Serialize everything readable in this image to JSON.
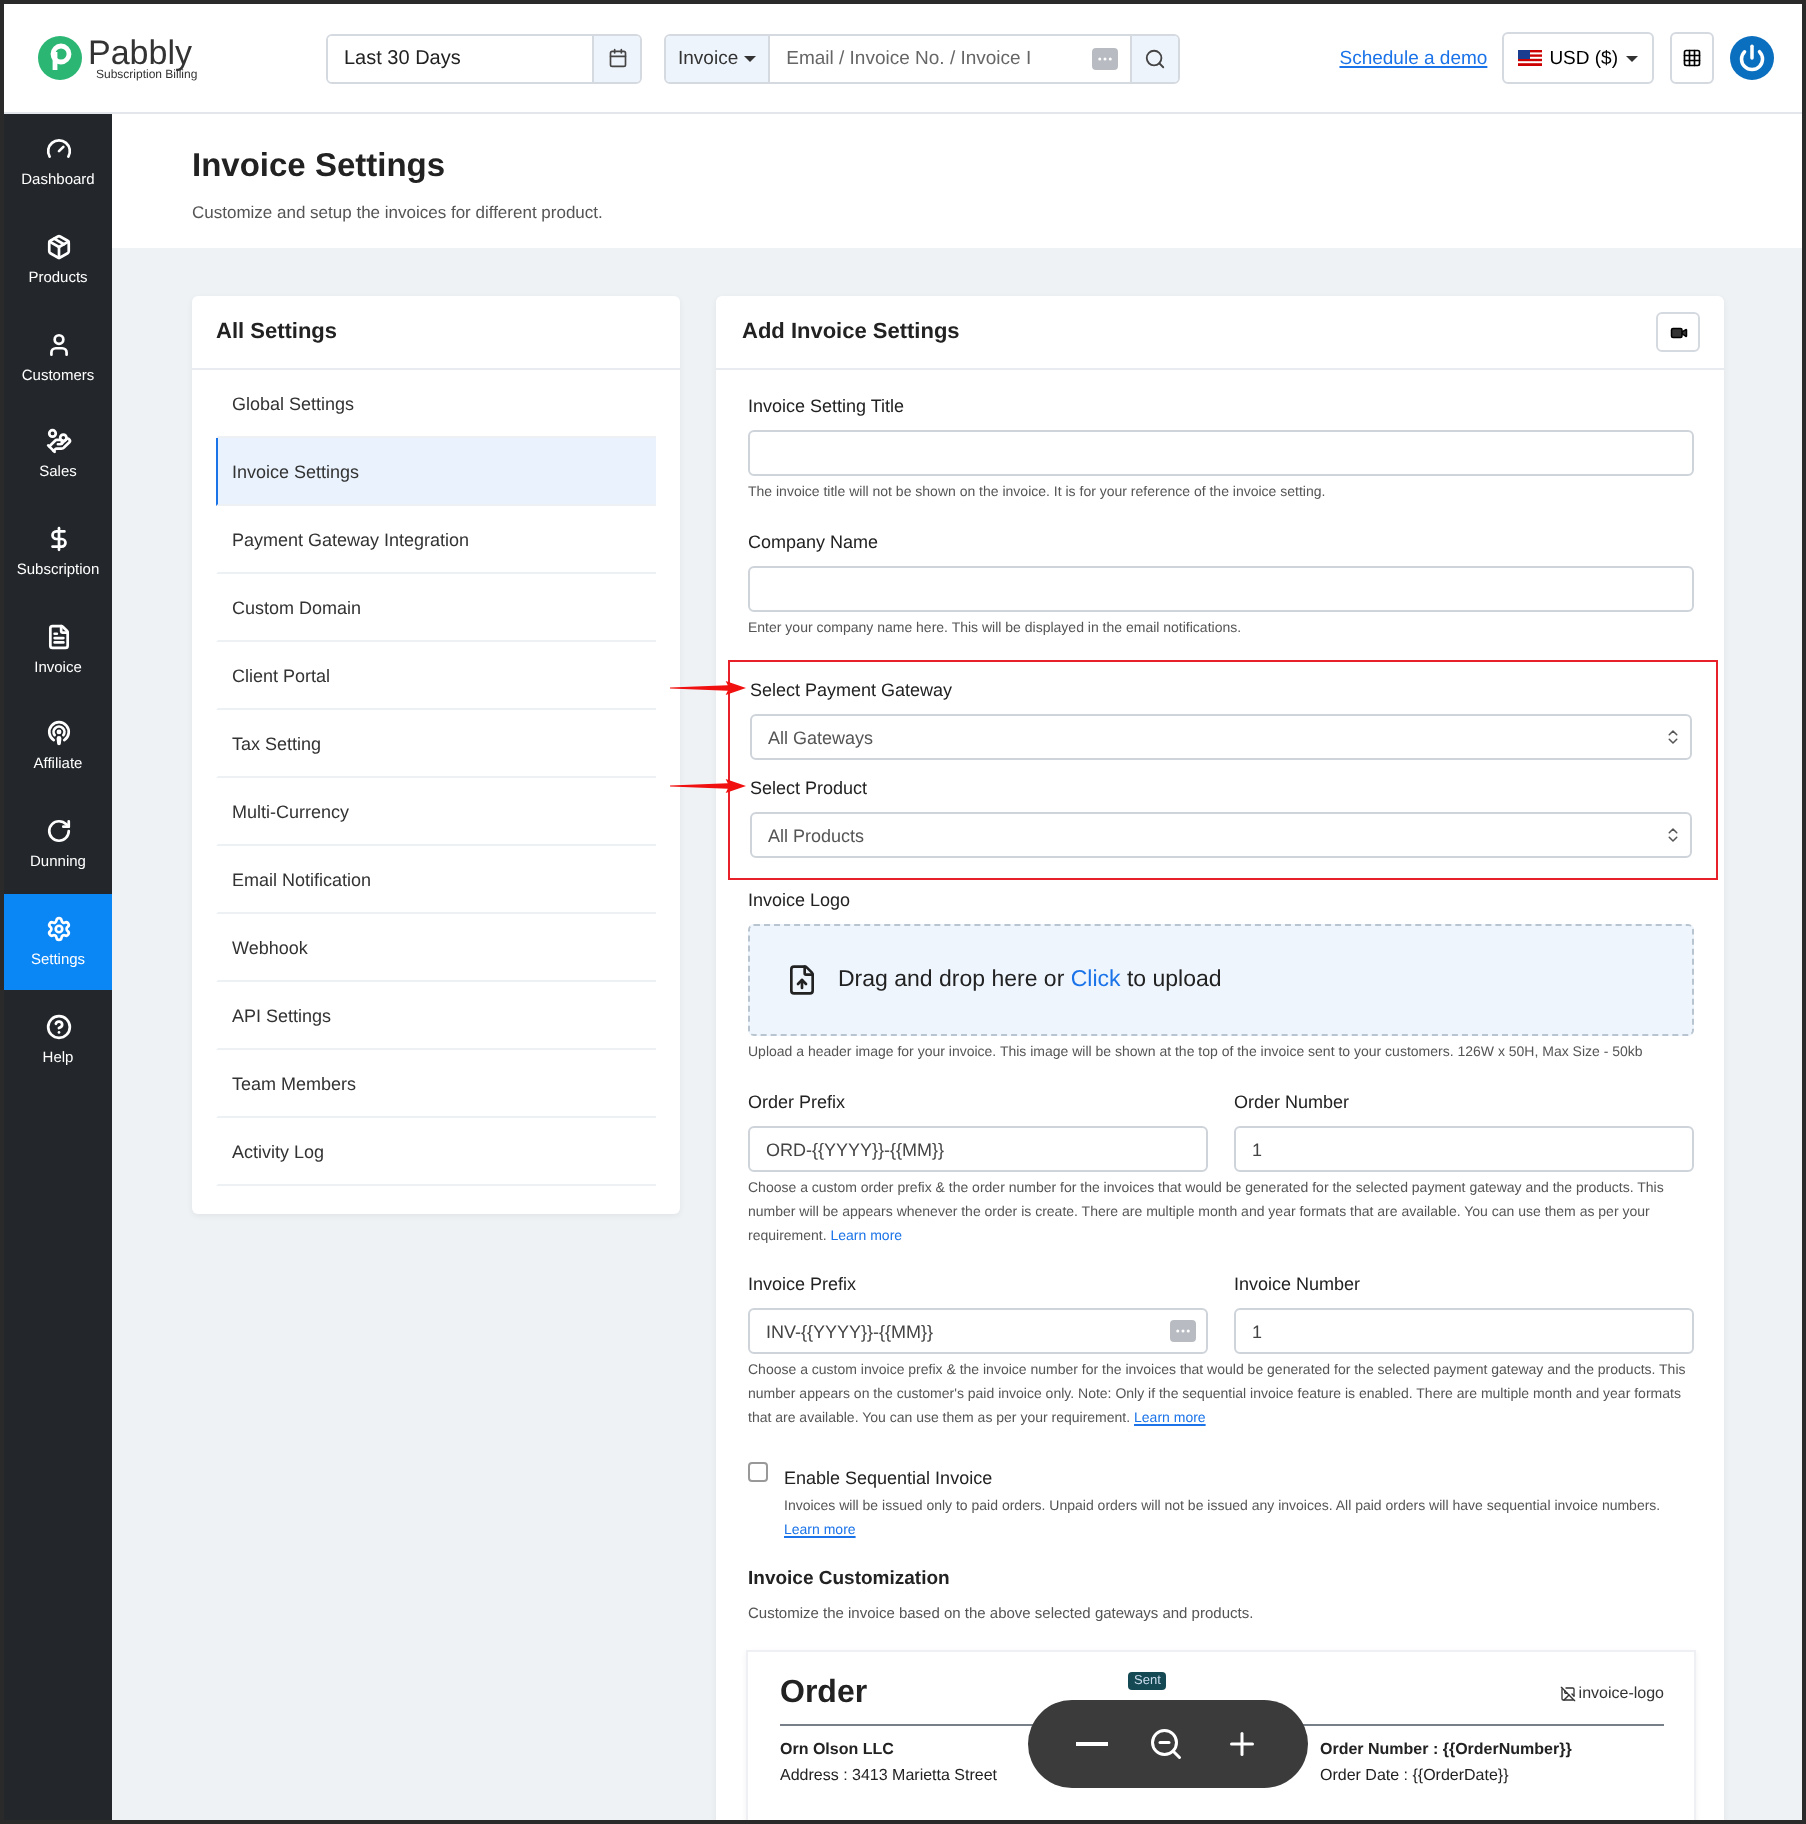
{
  "topbar": {
    "brand": "Pabbly",
    "brand_sub": "Subscription Billing",
    "date_range": "Last 30 Days",
    "search_type": "Invoice",
    "search_placeholder": "Email / Invoice No. / Invoice I",
    "demo_link": "Schedule a demo",
    "currency": "USD ($)"
  },
  "sidebar": {
    "items": [
      {
        "label": "Dashboard",
        "selected": false
      },
      {
        "label": "Products",
        "selected": false
      },
      {
        "label": "Customers",
        "selected": false
      },
      {
        "label": "Sales",
        "selected": false
      },
      {
        "label": "Subscription",
        "selected": false
      },
      {
        "label": "Invoice",
        "selected": false
      },
      {
        "label": "Affiliate",
        "selected": false
      },
      {
        "label": "Dunning",
        "selected": false
      },
      {
        "label": "Settings",
        "selected": true
      },
      {
        "label": "Help",
        "selected": false
      }
    ]
  },
  "page_header": {
    "title": "Invoice Settings",
    "subtitle": "Customize and setup the invoices for different product."
  },
  "settings_menu": {
    "title": "All Settings",
    "items": [
      {
        "label": "Global Settings",
        "selected": false
      },
      {
        "label": "Invoice Settings",
        "selected": true
      },
      {
        "label": "Payment Gateway Integration",
        "selected": false
      },
      {
        "label": "Custom Domain",
        "selected": false
      },
      {
        "label": "Client Portal",
        "selected": false
      },
      {
        "label": "Tax Setting",
        "selected": false
      },
      {
        "label": "Multi-Currency",
        "selected": false
      },
      {
        "label": "Email Notification",
        "selected": false
      },
      {
        "label": "Webhook",
        "selected": false
      },
      {
        "label": "API Settings",
        "selected": false
      },
      {
        "label": "Team Members",
        "selected": false
      },
      {
        "label": "Activity Log",
        "selected": false
      }
    ]
  },
  "form": {
    "title": "Add Invoice Settings",
    "fields": [
      {
        "kind": "text",
        "label": "Invoice Setting Title",
        "help": "The invoice title will not be shown on the invoice. It is for your reference of the invoice setting."
      },
      {
        "kind": "text",
        "label": "Company Name",
        "help": "Enter your company name here. This will be displayed in the email notifications."
      },
      {
        "kind": "highlight_group",
        "fields": [
          {
            "kind": "select",
            "label": "Select Payment Gateway",
            "value": "All Gateways"
          },
          {
            "kind": "select",
            "label": "Select Product",
            "value": "All Products"
          }
        ]
      },
      {
        "kind": "upload",
        "label": "Invoice Logo",
        "text_before": "Drag and drop here or",
        "click_text": "Click",
        "text_after": "to upload",
        "help": "Upload a header image for your invoice. This image will be shown at the top of the invoice sent to your customers. 126W x 50H, Max Size - 50kb"
      },
      {
        "kind": "pair",
        "left_label": "Order Prefix",
        "left_value": "ORD-{{YYYY}}-{{MM}}",
        "left_badge": false,
        "right_label": "Order Number",
        "right_value": "1",
        "help": "Choose a custom order prefix & the order number for the invoices that would be generated for the selected payment gateway and the products. This number will be appears whenever the order is create. There are multiple month and year formats that are available. You can use them as per your requirement.",
        "link": "Learn more",
        "underline": false
      },
      {
        "kind": "pair",
        "left_label": "Invoice Prefix",
        "left_value": "INV-{{YYYY}}-{{MM}}",
        "left_badge": true,
        "right_label": "Invoice Number",
        "right_value": "1",
        "help": "Choose a custom invoice prefix & the invoice number for the invoices that would be generated for the selected payment gateway and the products. This number appears on the customer's paid invoice only. Note: Only if the sequential invoice feature is enabled. There are multiple month and year formats that are available. You can use them as per your requirement.",
        "link": "Learn more",
        "underline": true
      },
      {
        "kind": "checkbox",
        "label": "Enable Sequential Invoice",
        "checked": false,
        "help": "Invoices will be issued only to paid orders. Unpaid orders will not be issued any invoices. All paid orders will have sequential invoice numbers.",
        "link": "Learn more"
      }
    ],
    "section_title": "Invoice Customization",
    "section_subtitle": "Customize the invoice based on the above selected gateways and products."
  },
  "preview": {
    "title": "Order",
    "logo_alt": "invoice-logo",
    "company": "Orn Olson LLC",
    "address": "Address : 3413 Marietta Street",
    "order_number": "Order Number : {{OrderNumber}}",
    "order_date": "Order Date : {{OrderDate}}"
  },
  "zoom_toolbar": {
    "tooltip": "Sent"
  }
}
